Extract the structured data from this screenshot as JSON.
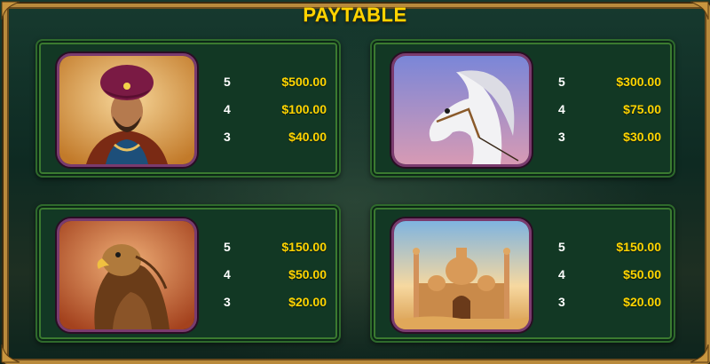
{
  "title": "PAYTABLE",
  "symbols": [
    {
      "icon": "sultan-icon",
      "payouts": [
        {
          "count": "5",
          "amount": "$500.00"
        },
        {
          "count": "4",
          "amount": "$100.00"
        },
        {
          "count": "3",
          "amount": "$40.00"
        }
      ]
    },
    {
      "icon": "white-horse-icon",
      "payouts": [
        {
          "count": "5",
          "amount": "$300.00"
        },
        {
          "count": "4",
          "amount": "$75.00"
        },
        {
          "count": "3",
          "amount": "$30.00"
        }
      ]
    },
    {
      "icon": "eagle-icon",
      "payouts": [
        {
          "count": "5",
          "amount": "$150.00"
        },
        {
          "count": "4",
          "amount": "$50.00"
        },
        {
          "count": "3",
          "amount": "$20.00"
        }
      ]
    },
    {
      "icon": "palace-icon",
      "payouts": [
        {
          "count": "5",
          "amount": "$150.00"
        },
        {
          "count": "4",
          "amount": "$50.00"
        },
        {
          "count": "3",
          "amount": "$20.00"
        }
      ]
    }
  ],
  "colors": {
    "title": "#ffd400",
    "amount": "#ffd400",
    "count": "#ffffff",
    "panel": "#123824",
    "frame": "#b98a3c"
  }
}
